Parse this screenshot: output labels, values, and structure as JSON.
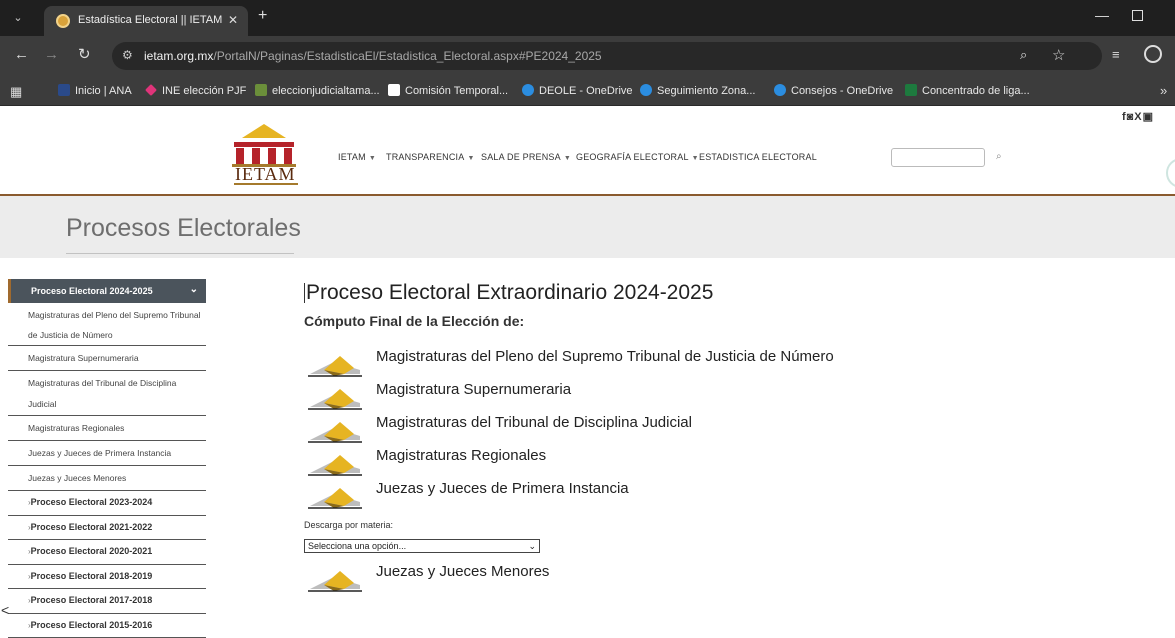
{
  "browser": {
    "tab_title": "Estadística Electoral || IETAM",
    "tab_close": "✕",
    "new_tab": "+",
    "url_host": "ietam.org.mx",
    "url_path": "/PortalN/Paginas/EstadisticaEl/Estadistica_Electoral.aspx#PE2024_2025",
    "bookmarks": [
      {
        "label": "Inicio | ANA",
        "color": "#2a4a8a"
      },
      {
        "label": "INE elección PJF",
        "color": "#e0347a"
      },
      {
        "label": "eleccionjudicialtama...",
        "color": "#6b8f3a"
      },
      {
        "label": "Comisión Temporal...",
        "color": "#ffffff"
      },
      {
        "label": "DEOLE - OneDrive",
        "color": "#2b8de0"
      },
      {
        "label": "Seguimiento Zona...",
        "color": "#2b8de0"
      },
      {
        "label": "Consejos - OneDrive",
        "color": "#2b8de0"
      },
      {
        "label": "Concentrado de liga...",
        "color": "#1d7a3e"
      }
    ]
  },
  "header": {
    "logo_text": "IETAM",
    "social": "f◙X▣",
    "nav": [
      {
        "label": "IETAM",
        "dropdown": true
      },
      {
        "label": "TRANSPARENCIA",
        "dropdown": true
      },
      {
        "label": "SALA DE PRENSA",
        "dropdown": true
      },
      {
        "label": "GEOGRAFÍA ELECTORAL",
        "dropdown": true
      },
      {
        "label": "ESTADISTICA ELECTORAL",
        "dropdown": false
      }
    ],
    "search_placeholder": ""
  },
  "banner": {
    "title": "Procesos Electorales"
  },
  "sidebar": {
    "active": "Proceso Electoral 2024-2025",
    "subitems": [
      "Magistraturas del Pleno del Supremo Tribunal de Justicia de Número",
      "Magistratura Supernumeraria",
      "Magistraturas del Tribunal de Disciplina Judicial",
      "Magistraturas Regionales",
      "Juezas y Jueces de Primera Instancia",
      "Juezas y Jueces Menores"
    ],
    "processes": [
      "Proceso Electoral 2023-2024",
      "Proceso Electoral 2021-2022",
      "Proceso Electoral 2020-2021",
      "Proceso Electoral 2018-2019",
      "Proceso Electoral 2017-2018",
      "Proceso Electoral 2015-2016"
    ]
  },
  "main": {
    "title": "Proceso Electoral Extraordinario 2024-2025",
    "subtitle": "Cómputo Final de la Elección de:",
    "elections": [
      "Magistraturas del Pleno del Supremo Tribunal de Justicia de Número",
      "Magistratura Supernumeraria",
      "Magistraturas del Tribunal de Disciplina Judicial",
      "Magistraturas Regionales",
      "Juezas y Jueces de Primera Instancia"
    ],
    "download_label": "Descarga por materia:",
    "select_value": "Selecciona una opción...",
    "last_election": "Juezas y Jueces Menores"
  },
  "colors": {
    "accent_brown": "#8a5a2e",
    "ballot_gold": "#e6b422",
    "sidebar_active": "#4b545c"
  }
}
